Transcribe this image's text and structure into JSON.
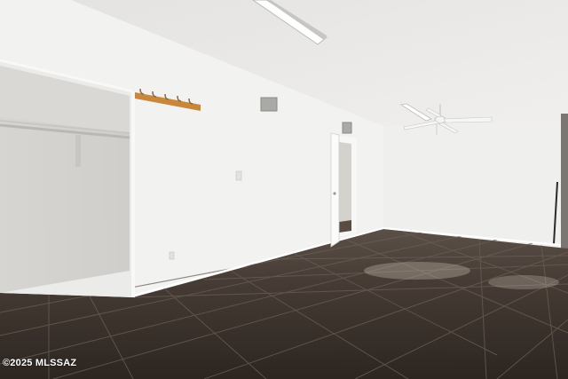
{
  "photo": {
    "description_none": "",
    "watermark": "©2025 MLSSAZ"
  },
  "colors": {
    "ceiling": "#e9e8e6",
    "wall_left": "#f1f1ef",
    "wall_back": "#eeeeec",
    "closet_interior": "#dcdbd8",
    "floor_tile": "#3b332d",
    "grout": "#6f655c",
    "hook_rail": "#c98a3c"
  },
  "icons": [
    "ceiling-light",
    "ceiling-fan",
    "wall-vent",
    "coat-hook-rail"
  ]
}
